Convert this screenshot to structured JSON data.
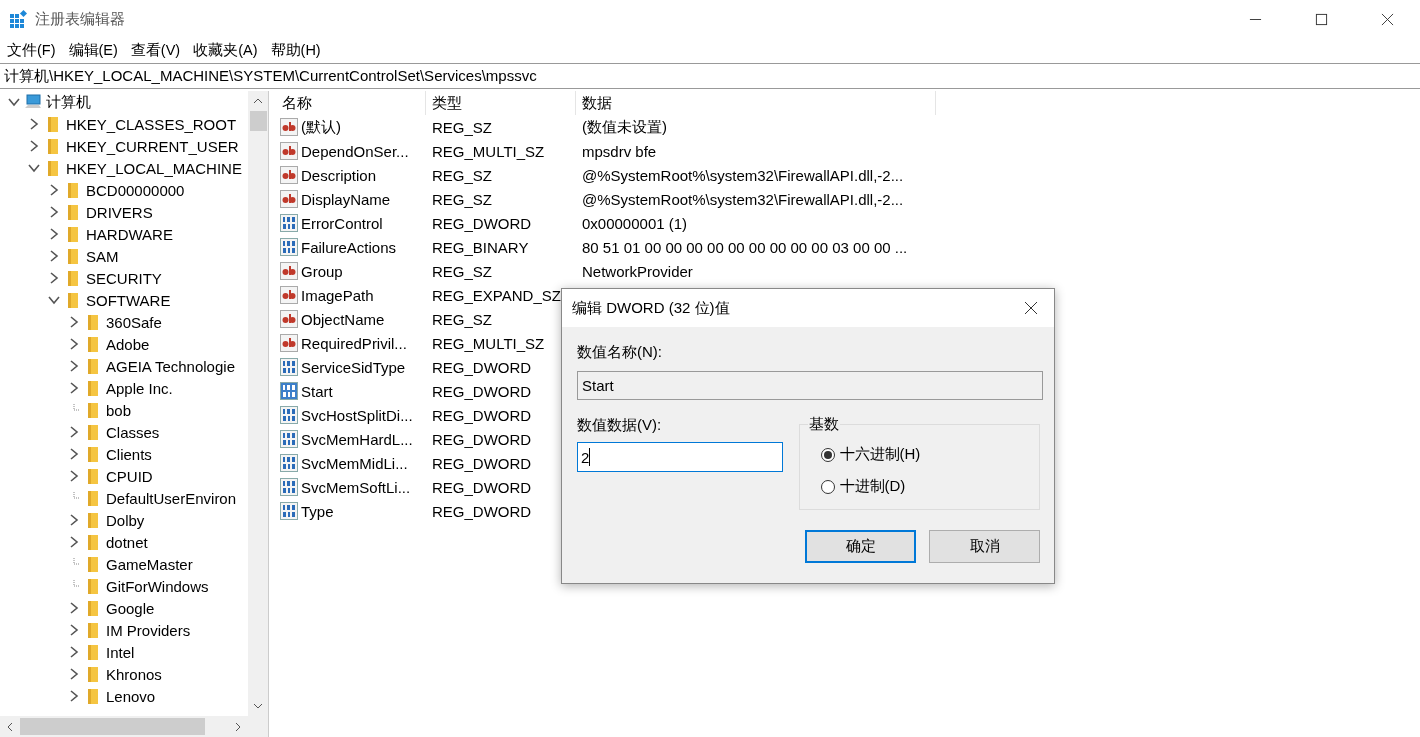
{
  "window": {
    "title": "注册表编辑器"
  },
  "menu": [
    "文件(F)",
    "编辑(E)",
    "查看(V)",
    "收藏夹(A)",
    "帮助(H)"
  ],
  "address": "计算机\\HKEY_LOCAL_MACHINE\\SYSTEM\\CurrentControlSet\\Services\\mpssvc",
  "tree": [
    {
      "label": "计算机",
      "kind": "computer",
      "expandable": true,
      "expanded": true,
      "children": [
        {
          "label": "HKEY_CLASSES_ROOT",
          "kind": "folder",
          "expandable": true,
          "expanded": false
        },
        {
          "label": "HKEY_CURRENT_USER",
          "kind": "folder",
          "expandable": true,
          "expanded": false
        },
        {
          "label": "HKEY_LOCAL_MACHINE",
          "kind": "folder",
          "expandable": true,
          "expanded": true,
          "children": [
            {
              "label": "BCD00000000",
              "kind": "folder",
              "expandable": true,
              "expanded": false
            },
            {
              "label": "DRIVERS",
              "kind": "folder",
              "expandable": true,
              "expanded": false
            },
            {
              "label": "HARDWARE",
              "kind": "folder",
              "expandable": true,
              "expanded": false
            },
            {
              "label": "SAM",
              "kind": "folder",
              "expandable": true,
              "expanded": false
            },
            {
              "label": "SECURITY",
              "kind": "folder",
              "expandable": true,
              "expanded": false
            },
            {
              "label": "SOFTWARE",
              "kind": "folder",
              "expandable": true,
              "expanded": true,
              "children": [
                {
                  "label": "360Safe",
                  "kind": "folder",
                  "expandable": true,
                  "expanded": false
                },
                {
                  "label": "Adobe",
                  "kind": "folder",
                  "expandable": true,
                  "expanded": false
                },
                {
                  "label": "AGEIA Technologie",
                  "kind": "folder",
                  "expandable": true,
                  "expanded": false
                },
                {
                  "label": "Apple Inc.",
                  "kind": "folder",
                  "expandable": true,
                  "expanded": false
                },
                {
                  "label": "bob",
                  "kind": "folder",
                  "expandable": false
                },
                {
                  "label": "Classes",
                  "kind": "folder",
                  "expandable": true,
                  "expanded": false
                },
                {
                  "label": "Clients",
                  "kind": "folder",
                  "expandable": true,
                  "expanded": false
                },
                {
                  "label": "CPUID",
                  "kind": "folder",
                  "expandable": true,
                  "expanded": false
                },
                {
                  "label": "DefaultUserEnviron",
                  "kind": "folder",
                  "expandable": false
                },
                {
                  "label": "Dolby",
                  "kind": "folder",
                  "expandable": true,
                  "expanded": false
                },
                {
                  "label": "dotnet",
                  "kind": "folder",
                  "expandable": true,
                  "expanded": false
                },
                {
                  "label": "GameMaster",
                  "kind": "folder",
                  "expandable": false
                },
                {
                  "label": "GitForWindows",
                  "kind": "folder",
                  "expandable": false
                },
                {
                  "label": "Google",
                  "kind": "folder",
                  "expandable": true,
                  "expanded": false
                },
                {
                  "label": "IM Providers",
                  "kind": "folder",
                  "expandable": true,
                  "expanded": false
                },
                {
                  "label": "Intel",
                  "kind": "folder",
                  "expandable": true,
                  "expanded": false
                },
                {
                  "label": "Khronos",
                  "kind": "folder",
                  "expandable": true,
                  "expanded": false
                },
                {
                  "label": "Lenovo",
                  "kind": "folder",
                  "expandable": true,
                  "expanded": false
                }
              ]
            }
          ]
        }
      ]
    }
  ],
  "columns": [
    "名称",
    "类型",
    "数据"
  ],
  "values": [
    {
      "kind": "text",
      "name": "(默认)",
      "type": "REG_SZ",
      "data": "(数值未设置)",
      "selected": false
    },
    {
      "kind": "text",
      "name": "DependOnSer...",
      "type": "REG_MULTI_SZ",
      "data": "mpsdrv bfe",
      "selected": false
    },
    {
      "kind": "text",
      "name": "Description",
      "type": "REG_SZ",
      "data": "@%SystemRoot%\\system32\\FirewallAPI.dll,-2...",
      "selected": false
    },
    {
      "kind": "text",
      "name": "DisplayName",
      "type": "REG_SZ",
      "data": "@%SystemRoot%\\system32\\FirewallAPI.dll,-2...",
      "selected": false
    },
    {
      "kind": "number",
      "name": "ErrorControl",
      "type": "REG_DWORD",
      "data": "0x00000001 (1)",
      "selected": false
    },
    {
      "kind": "number",
      "name": "FailureActions",
      "type": "REG_BINARY",
      "data": "80 51 01 00 00 00 00 00 00 00 00 00 03 00 00 ...",
      "selected": false
    },
    {
      "kind": "text",
      "name": "Group",
      "type": "REG_SZ",
      "data": "NetworkProvider",
      "selected": false
    },
    {
      "kind": "text",
      "name": "ImagePath",
      "type": "REG_EXPAND_SZ",
      "selected": false
    },
    {
      "kind": "text",
      "name": "ObjectName",
      "type": "REG_SZ",
      "selected": false
    },
    {
      "kind": "text",
      "name": "RequiredPrivil...",
      "type": "REG_MULTI_SZ",
      "selected": false
    },
    {
      "kind": "number",
      "name": "ServiceSidType",
      "type": "REG_DWORD",
      "selected": false
    },
    {
      "kind": "number",
      "name": "Start",
      "type": "REG_DWORD",
      "selected": true
    },
    {
      "kind": "number",
      "name": "SvcHostSplitDi...",
      "type": "REG_DWORD",
      "selected": false
    },
    {
      "kind": "number",
      "name": "SvcMemHardL...",
      "type": "REG_DWORD",
      "selected": false
    },
    {
      "kind": "number",
      "name": "SvcMemMidLi...",
      "type": "REG_DWORD",
      "selected": false
    },
    {
      "kind": "number",
      "name": "SvcMemSoftLi...",
      "type": "REG_DWORD",
      "selected": false
    },
    {
      "kind": "number",
      "name": "Type",
      "type": "REG_DWORD",
      "selected": false
    }
  ],
  "dialog": {
    "title": "编辑 DWORD (32 位)值",
    "name_label": "数值名称(N):",
    "name_value": "Start",
    "data_label": "数值数据(V):",
    "data_value": "2",
    "base_label": "基数",
    "bases": [
      {
        "label": "十六进制(H)",
        "selected": true
      },
      {
        "label": "十进制(D)",
        "selected": false
      }
    ],
    "buttons": [
      {
        "label": "确定",
        "default": true
      },
      {
        "label": "取消",
        "default": false
      }
    ]
  }
}
